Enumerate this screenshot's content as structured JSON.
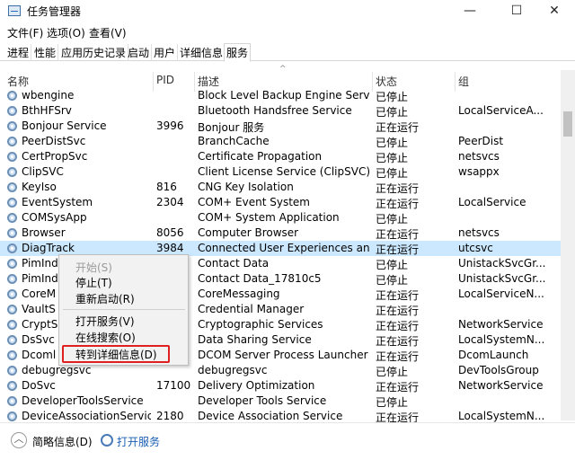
{
  "window": {
    "title": "任务管理器",
    "min_glyph": "—",
    "max_glyph": "☐",
    "close_glyph": "✕"
  },
  "menu": [
    "文件(F)",
    "选项(O)",
    "查看(V)"
  ],
  "tabs": [
    "进程",
    "性能",
    "应用历史记录",
    "启动",
    "用户",
    "详细信息",
    "服务"
  ],
  "columns": {
    "name": "名称",
    "pid": "PID",
    "desc": "描述",
    "status": "状态",
    "group": "组"
  },
  "rows": [
    {
      "name": "wbengine",
      "pid": "",
      "desc": "Block Level Backup Engine Service",
      "status": "已停止",
      "group": ""
    },
    {
      "name": "BthHFSrv",
      "pid": "",
      "desc": "Bluetooth Handsfree Service",
      "status": "已停止",
      "group": "LocalServiceA..."
    },
    {
      "name": "Bonjour Service",
      "pid": "3996",
      "desc": "Bonjour 服务",
      "status": "正在运行",
      "group": ""
    },
    {
      "name": "PeerDistSvc",
      "pid": "",
      "desc": "BranchCache",
      "status": "已停止",
      "group": "PeerDist"
    },
    {
      "name": "CertPropSvc",
      "pid": "",
      "desc": "Certificate Propagation",
      "status": "已停止",
      "group": "netsvcs"
    },
    {
      "name": "ClipSVC",
      "pid": "",
      "desc": "Client License Service (ClipSVC)",
      "status": "已停止",
      "group": "wsappx"
    },
    {
      "name": "KeyIso",
      "pid": "816",
      "desc": "CNG Key Isolation",
      "status": "正在运行",
      "group": ""
    },
    {
      "name": "EventSystem",
      "pid": "2304",
      "desc": "COM+ Event System",
      "status": "正在运行",
      "group": "LocalService"
    },
    {
      "name": "COMSysApp",
      "pid": "",
      "desc": "COM+ System Application",
      "status": "已停止",
      "group": ""
    },
    {
      "name": "Browser",
      "pid": "8056",
      "desc": "Computer Browser",
      "status": "正在运行",
      "group": "netsvcs"
    },
    {
      "name": "DiagTrack",
      "pid": "3984",
      "desc": "Connected User Experiences and T...",
      "status": "正在运行",
      "group": "utcsvc"
    },
    {
      "name": "PimInd",
      "pid": "",
      "desc": "Contact Data",
      "status": "已停止",
      "group": "UnistackSvcGr..."
    },
    {
      "name": "PimInd",
      "pid": "",
      "desc": "Contact Data_17810c5",
      "status": "已停止",
      "group": "UnistackSvcGr..."
    },
    {
      "name": "CoreM",
      "pid": "",
      "desc": "CoreMessaging",
      "status": "正在运行",
      "group": "LocalServiceN..."
    },
    {
      "name": "VaultS",
      "pid": "",
      "desc": "Credential Manager",
      "status": "正在运行",
      "group": ""
    },
    {
      "name": "CryptS",
      "pid": "",
      "desc": "Cryptographic Services",
      "status": "正在运行",
      "group": "NetworkService"
    },
    {
      "name": "DsSvc",
      "pid": "",
      "desc": "Data Sharing Service",
      "status": "正在运行",
      "group": "LocalSystemN..."
    },
    {
      "name": "Dcoml",
      "pid": "",
      "desc": "DCOM Server Process Launcher",
      "status": "正在运行",
      "group": "DcomLaunch"
    },
    {
      "name": "debugregsvc",
      "pid": "",
      "desc": "debugregsvc",
      "status": "已停止",
      "group": "DevToolsGroup"
    },
    {
      "name": "DoSvc",
      "pid": "17100",
      "desc": "Delivery Optimization",
      "status": "正在运行",
      "group": "NetworkService"
    },
    {
      "name": "DeveloperToolsService",
      "pid": "",
      "desc": "Developer Tools Service",
      "status": "已停止",
      "group": ""
    },
    {
      "name": "DeviceAssociationService",
      "pid": "2180",
      "desc": "Device Association Service",
      "status": "正在运行",
      "group": "LocalSystemN..."
    },
    {
      "name": "",
      "pid": "",
      "desc": "",
      "status": "正在运行",
      "group": ""
    },
    {
      "name": "",
      "pid": "",
      "desc": "",
      "status": "正在运行",
      "group": ""
    }
  ],
  "context_menu": {
    "start": "开始(S)",
    "stop": "停止(T)",
    "restart": "重新启动(R)",
    "open_services": "打开服务(V)",
    "search_online": "在线搜索(O)",
    "goto_details": "转到详细信息(D)"
  },
  "status": {
    "collapse_glyph": "︿",
    "brief": "简略信息(D)",
    "open_services": "打开服务"
  },
  "colors": {
    "selected_row": "#cce8ff",
    "highlight_border": "#e02020",
    "link": "#1a5fb4"
  }
}
